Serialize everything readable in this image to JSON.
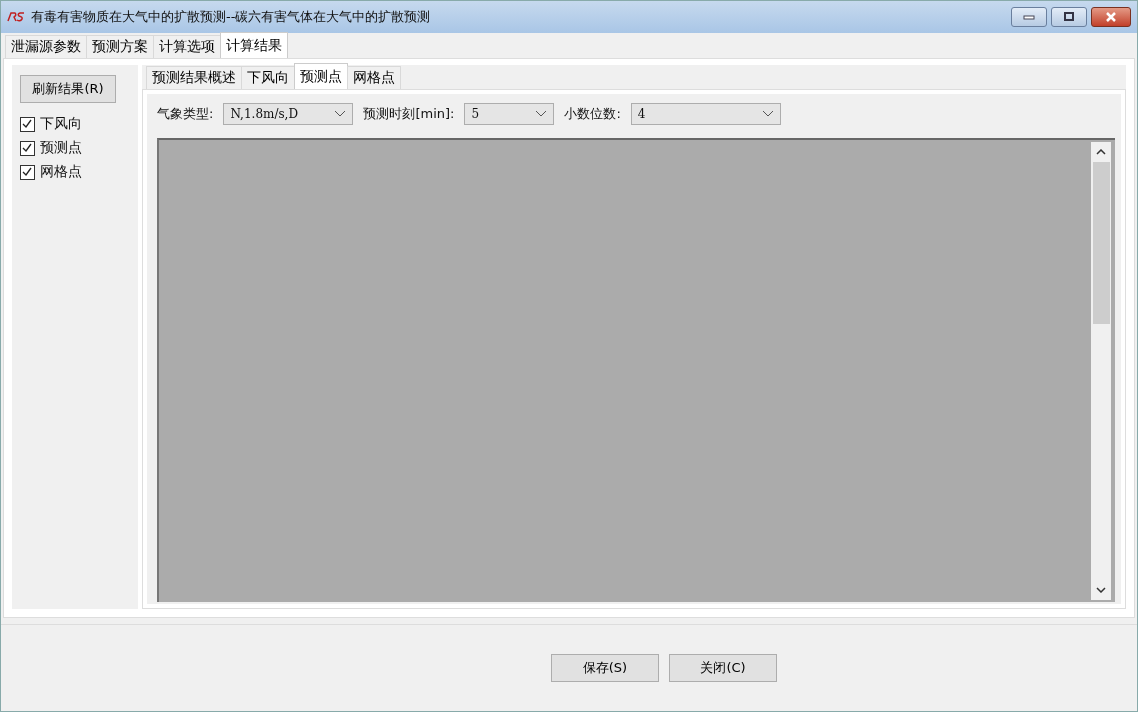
{
  "window": {
    "title": "有毒有害物质在大气中的扩散预测--碳六有害气体在大气中的扩散预测"
  },
  "tabs": [
    {
      "label": "泄漏源参数",
      "selected": false
    },
    {
      "label": "预测方案",
      "selected": false
    },
    {
      "label": "计算选项",
      "selected": false
    },
    {
      "label": "计算结果",
      "selected": true
    }
  ],
  "refresh_button": "刷新结果(R)",
  "layers": [
    {
      "label": "下风向",
      "checked": true
    },
    {
      "label": "预测点",
      "checked": true
    },
    {
      "label": "网格点",
      "checked": true
    }
  ],
  "sub_tabs": [
    {
      "label": "预测结果概述",
      "selected": false
    },
    {
      "label": "下风向",
      "selected": false
    },
    {
      "label": "预测点",
      "selected": true
    },
    {
      "label": "网格点",
      "selected": false
    }
  ],
  "filters": [
    {
      "label": "气象类型:",
      "value": "N,1.8m/s,D"
    },
    {
      "label": "预测时刻[min]:",
      "value": "5"
    },
    {
      "label": "小数位数:",
      "value": "4"
    }
  ],
  "buttons": [
    "保存(S)",
    "关闭(C)"
  ]
}
